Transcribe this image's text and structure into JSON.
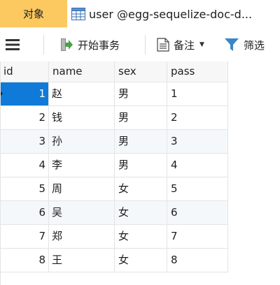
{
  "tabs": {
    "objects_label": "对象",
    "table_tab_label": "user @egg-sequelize-doc-d..."
  },
  "toolbar": {
    "begin_transaction_label": "开始事务",
    "note_label": "备注",
    "filter_label": "筛选",
    "icons": [
      "menu-icon",
      "transaction-icon",
      "note-icon",
      "filter-icon"
    ]
  },
  "grid": {
    "columns": [
      "id",
      "name",
      "sex",
      "pass"
    ],
    "rows": [
      {
        "id": "1",
        "name": "赵",
        "sex": "男",
        "pass": "1"
      },
      {
        "id": "2",
        "name": "钱",
        "sex": "男",
        "pass": "2"
      },
      {
        "id": "3",
        "name": "孙",
        "sex": "男",
        "pass": "3"
      },
      {
        "id": "4",
        "name": "李",
        "sex": "男",
        "pass": "4"
      },
      {
        "id": "5",
        "name": "周",
        "sex": "女",
        "pass": "5"
      },
      {
        "id": "6",
        "name": "吴",
        "sex": "女",
        "pass": "6"
      },
      {
        "id": "7",
        "name": "郑",
        "sex": "女",
        "pass": "7"
      },
      {
        "id": "8",
        "name": "王",
        "sex": "女",
        "pass": "8"
      }
    ]
  },
  "colors": {
    "objects_tab": "#fbc960",
    "selection": "#0f7ad8",
    "transaction_icon_green": "#49a04b",
    "filter_icon_blue": "#3a86c8"
  }
}
